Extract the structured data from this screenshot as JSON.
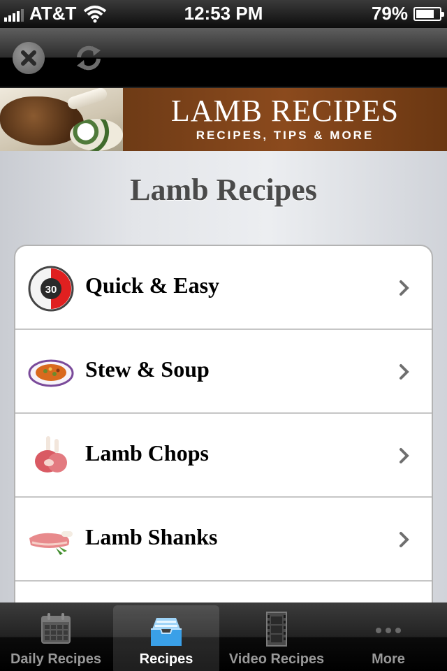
{
  "status_bar": {
    "carrier": "AT&T",
    "time": "12:53 PM",
    "battery_percent": "79%",
    "battery_level": 0.79
  },
  "toolbar": {
    "close_icon": "close-icon",
    "refresh_icon": "refresh-icon"
  },
  "banner": {
    "title": "LAMB RECIPES",
    "subtitle": "RECIPES, TIPS & MORE"
  },
  "page": {
    "title": "Lamb Recipes"
  },
  "list": {
    "items": [
      {
        "label": "Quick & Easy",
        "icon": "timer-30-icon"
      },
      {
        "label": "Stew & Soup",
        "icon": "soup-bowl-icon"
      },
      {
        "label": "Lamb Chops",
        "icon": "lamb-chops-icon"
      },
      {
        "label": "Lamb Shanks",
        "icon": "lamb-shanks-icon"
      }
    ],
    "timer_number": "30"
  },
  "tabbar": {
    "tabs": [
      {
        "label": "Daily Recipes",
        "icon": "calendar-icon"
      },
      {
        "label": "Recipes",
        "icon": "inbox-tray-icon",
        "selected": true
      },
      {
        "label": "Video Recipes",
        "icon": "film-icon"
      },
      {
        "label": "More",
        "icon": "more-dots-icon"
      }
    ]
  },
  "colors": {
    "banner_brown": "#8b4a1d",
    "timer_red": "#e02020",
    "selected_tab_blue": "#3aa0e8"
  }
}
